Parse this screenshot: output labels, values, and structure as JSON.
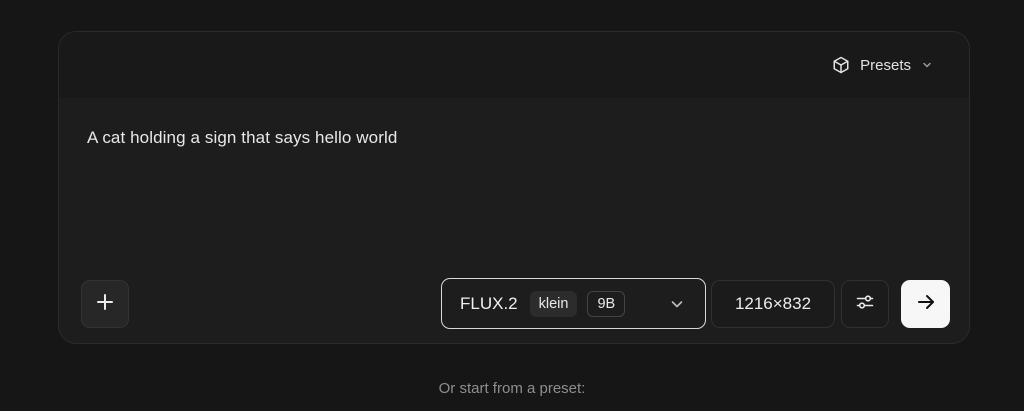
{
  "header": {
    "presets_label": "Presets",
    "presets_icon": "box-icon"
  },
  "prompt": {
    "text": "A cat holding a sign that says hello world"
  },
  "toolbar": {
    "add_icon": "plus-icon",
    "model": {
      "name": "FLUX.2",
      "variant": "klein",
      "size": "9B"
    },
    "resolution": "1216×832",
    "settings_icon": "sliders-icon",
    "submit_icon": "arrow-right-icon"
  },
  "footer": {
    "text": "Or start from a preset:"
  },
  "colors": {
    "background": "#161616",
    "card": "#1d1d1d",
    "submit": "#f7f7f7"
  }
}
